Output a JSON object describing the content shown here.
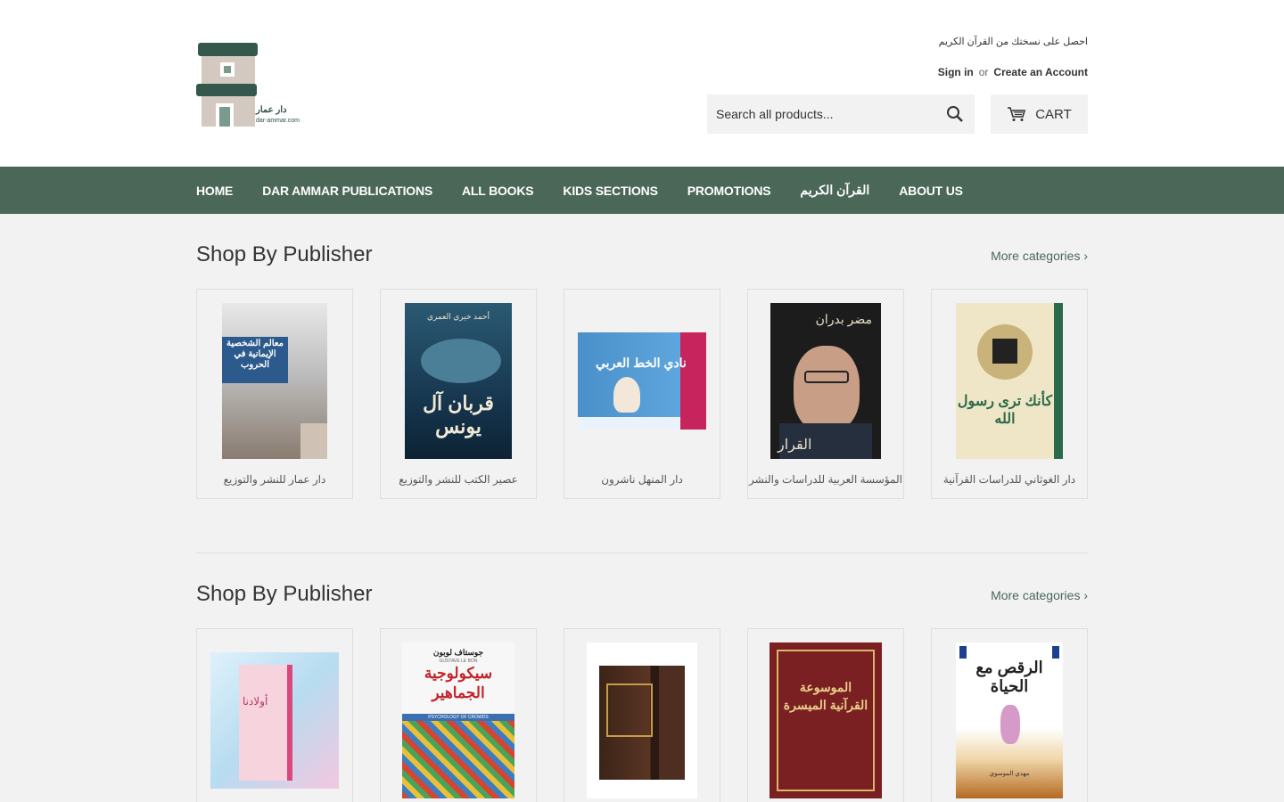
{
  "header": {
    "logo_text": "دار عمار",
    "logo_url": "dar-ammar.com",
    "promo_link": "احصل على نسختك من القرآن الكريم",
    "sign_in": "Sign in",
    "or": "or",
    "create_account": "Create an Account",
    "search_placeholder": "Search all products...",
    "cart_label": "CART"
  },
  "nav": {
    "items": [
      {
        "label": "HOME"
      },
      {
        "label": "DAR AMMAR PUBLICATIONS"
      },
      {
        "label": "ALL BOOKS"
      },
      {
        "label": "KIDS SECTIONS"
      },
      {
        "label": "PROMOTIONS"
      },
      {
        "label": "القرآن الكريم"
      },
      {
        "label": "ABOUT US"
      }
    ]
  },
  "sections": [
    {
      "title": "Shop By Publisher",
      "more": "More categories ›",
      "cards": [
        {
          "caption": "دار عمار للنشر والتوزيع",
          "cover_title": "معالم الشخصية الإيمانية في الحروب"
        },
        {
          "caption": "عصير الكتب للنشر والتوزيع",
          "cover_title": "قربان آل يونس",
          "cover_author": "أحمد خيري العمري"
        },
        {
          "caption": "دار المنهل ناشرون",
          "cover_title": "نادي الخط العربي"
        },
        {
          "caption": "المؤسسة العربية للدراسات والنشر",
          "cover_title": "القرار",
          "cover_author": "مضر بدران"
        },
        {
          "caption": "دار الغوثاني للدراسات القرآنية",
          "cover_title": "كأنك ترى رسول الله"
        }
      ]
    },
    {
      "title": "Shop By Publisher",
      "more": "More categories ›",
      "cards": [
        {
          "caption": "",
          "cover_title": "أولادنا"
        },
        {
          "caption": "",
          "cover_title": "سيكولوجية الجماهير",
          "cover_author": "جوستاف لوبون",
          "cover_author_en": "GUSTAVE LE BON",
          "cover_sub_en": "PSYCHOLOGY OF CROWDS"
        },
        {
          "caption": "",
          "cover_title": ""
        },
        {
          "caption": "",
          "cover_title": "الموسوعة القرآنية الميسرة"
        },
        {
          "caption": "",
          "cover_title": "الرقص مع الحياة",
          "cover_author": "مهدي الموسوي"
        }
      ]
    }
  ],
  "colors": {
    "nav_bg": "#4a6758",
    "accent": "#4a6758",
    "page_bg": "#f2f2f2"
  }
}
